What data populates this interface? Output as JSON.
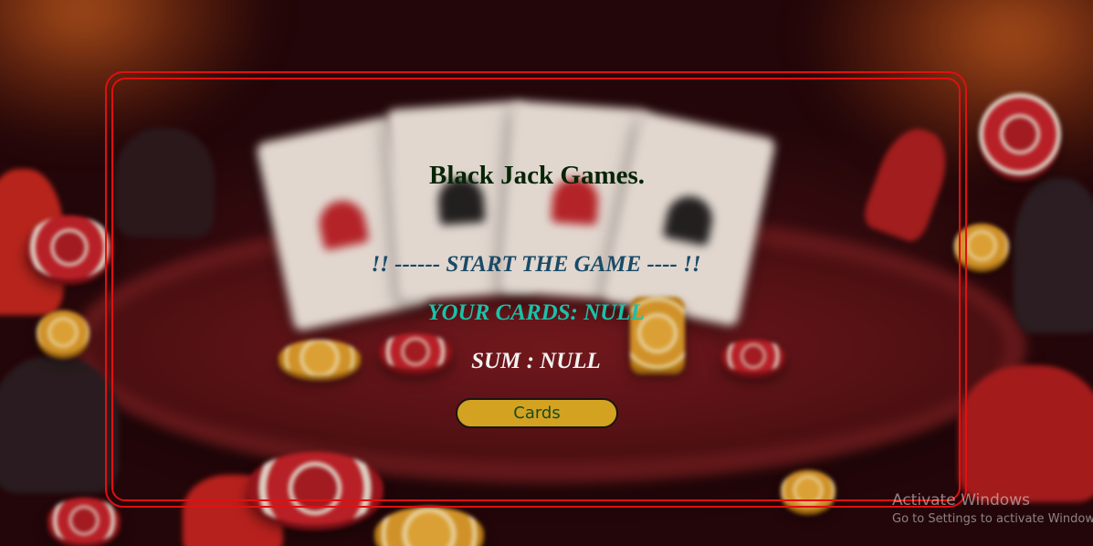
{
  "game": {
    "title": "Black Jack Games.",
    "start_message": "!! ------ START THE GAME ---- !!",
    "cards_text": "YOUR CARDS: NULL",
    "sum_text": "SUM : NULL",
    "cards_button_label": "Cards"
  },
  "watermark": {
    "title": "Activate Windows",
    "subtitle": "Go to Settings to activate Windows."
  },
  "colors": {
    "frame": "#e01010",
    "title": "#062406",
    "start_message": "#1a4a66",
    "cards_text": "#19c2a8",
    "sum_text": "#f2f2f2",
    "button_bg": "#d4a221",
    "button_text": "#1a4a1a"
  }
}
